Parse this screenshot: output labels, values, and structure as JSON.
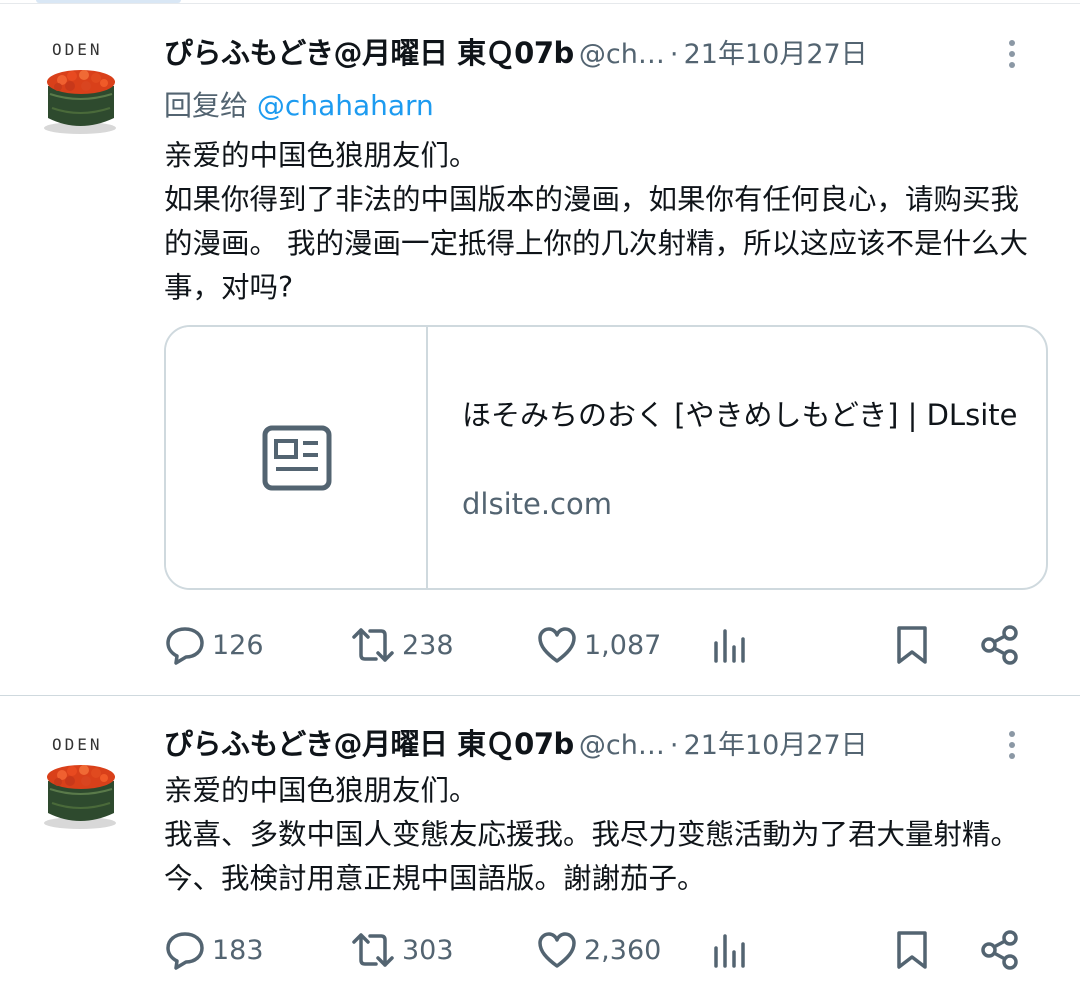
{
  "colors": {
    "text": "#0f1419",
    "secondary": "#536471",
    "link": "#1d9bf0",
    "border": "#cfd9de"
  },
  "tweets": [
    {
      "avatar_brand": "ODEN",
      "display_name": "ぴらふもどき@月曜日 東Ｑ07b",
      "handle": "@ch…",
      "dot": "·",
      "date": "21年10月27日",
      "reply_prefix": "回复给",
      "reply_to": "@chahaharn",
      "text": "亲爱的中国色狼朋友们。\n如果你得到了非法的中国版本的漫画，如果你有任何良心，请购买我的漫画。 我的漫画一定抵得上你的几次射精，所以这应该不是什么大事，对吗?",
      "card": {
        "icon": "article-icon",
        "title": "ほそみちのおく [やきめしもどき] | DLsite",
        "domain": "dlsite.com"
      },
      "replies": "126",
      "retweets": "238",
      "likes": "1,087"
    },
    {
      "avatar_brand": "ODEN",
      "display_name": "ぴらふもどき@月曜日 東Ｑ07b",
      "handle": "@ch…",
      "dot": "·",
      "date": "21年10月27日",
      "text": "亲爱的中国色狼朋友们。\n我喜、多数中国人变態友応援我。我尽力变態活動为了君大量射精。今、我検討用意正規中国語版。謝謝茄子。",
      "replies": "183",
      "retweets": "303",
      "likes": "2,360"
    }
  ]
}
